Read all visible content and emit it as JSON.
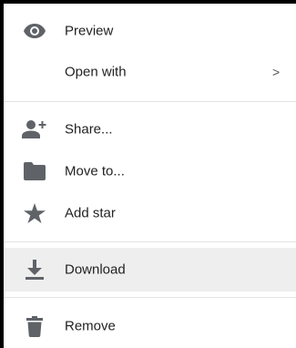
{
  "menu": {
    "items": [
      {
        "label": "Preview",
        "icon": "eye-icon"
      },
      {
        "label": "Open with",
        "submenu_indicator": ">"
      },
      {
        "label": "Share...",
        "icon": "add-person-icon"
      },
      {
        "label": "Move to...",
        "icon": "folder-icon"
      },
      {
        "label": "Add star",
        "icon": "star-icon"
      },
      {
        "label": "Download",
        "icon": "download-icon",
        "highlighted": true
      },
      {
        "label": "Remove",
        "icon": "trash-icon"
      }
    ]
  },
  "colors": {
    "icon": "#5f6368",
    "text": "#222222",
    "highlight": "#eeeeee",
    "divider": "#e2e2e2",
    "frame": "#000000"
  }
}
